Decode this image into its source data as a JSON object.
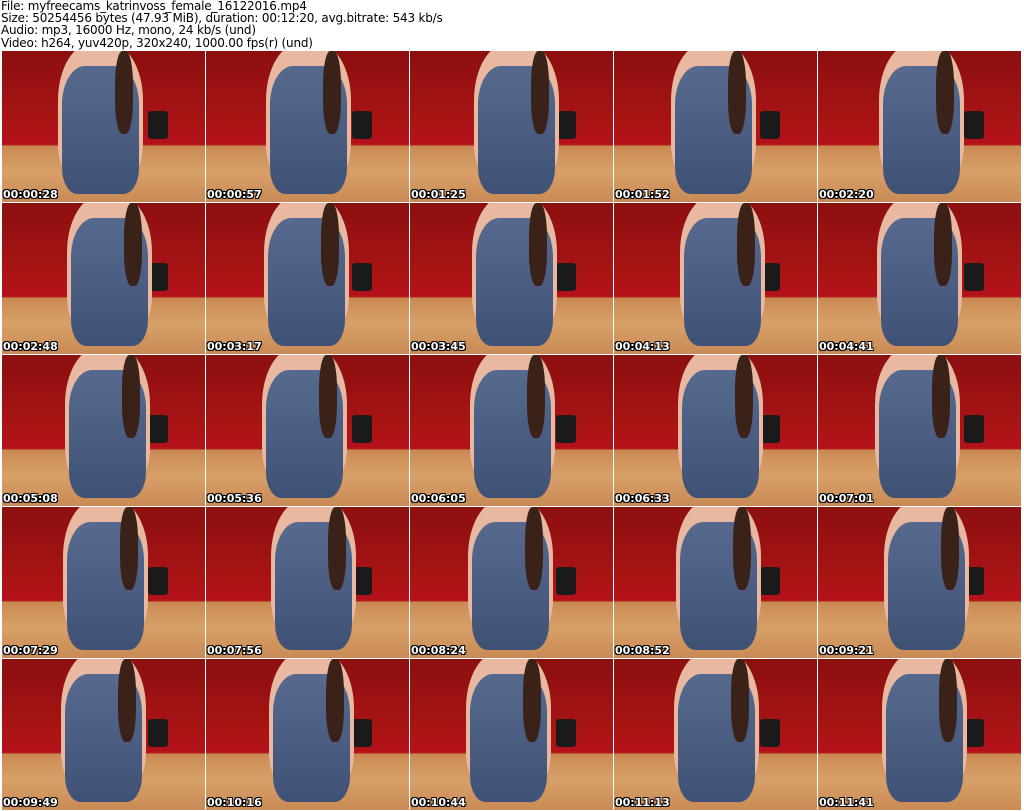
{
  "header": {
    "file": "File: myfreecams_katrinvoss_female_16122016.mp4",
    "size": "Size: 50254456 bytes (47.93 MiB), duration: 00:12:20, avg.bitrate: 543 kb/s",
    "audio": "Audio: mp3, 16000 Hz, mono, 24 kb/s (und)",
    "video": "Video: h264, yuv420p, 320x240, 1000.00 fps(r) (und)"
  },
  "thumbnails": [
    "00:00:28",
    "00:00:57",
    "00:01:25",
    "00:01:52",
    "00:02:20",
    "00:02:48",
    "00:03:17",
    "00:03:45",
    "00:04:13",
    "00:04:41",
    "00:05:08",
    "00:05:36",
    "00:06:05",
    "00:06:33",
    "00:07:01",
    "00:07:29",
    "00:07:56",
    "00:08:24",
    "00:08:52",
    "00:09:21",
    "00:09:49",
    "00:10:16",
    "00:10:44",
    "00:11:13",
    "00:11:41"
  ]
}
